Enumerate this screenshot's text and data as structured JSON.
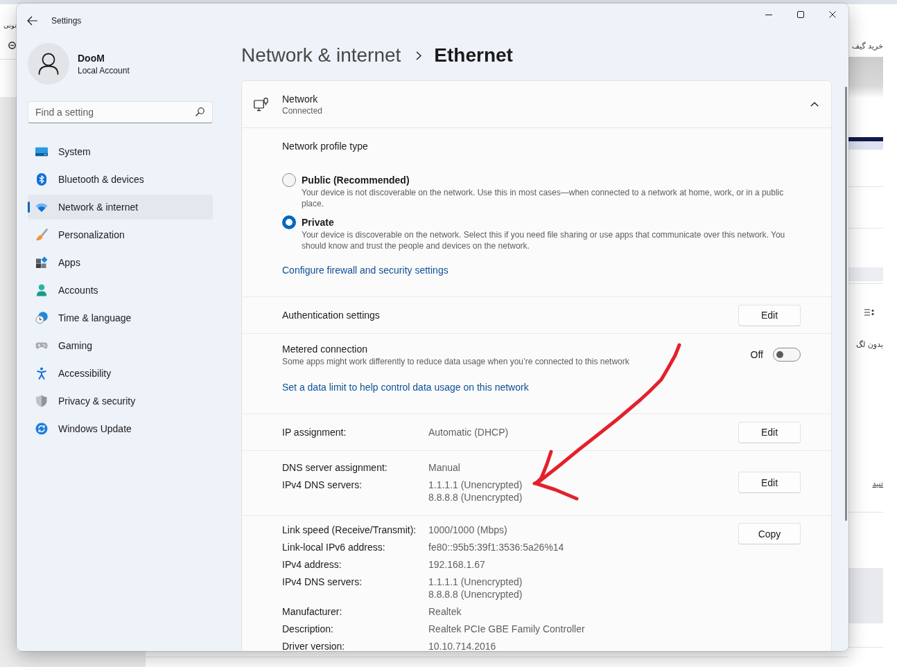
{
  "background_page": {
    "left_text": "تونی",
    "right_items": [
      {
        "kind": "text",
        "text": "خرید گیف"
      },
      {
        "kind": "text",
        "text": "بدون لگ"
      },
      {
        "kind": "link",
        "text": "تنید"
      }
    ]
  },
  "window": {
    "title": "Settings"
  },
  "profile": {
    "name": "DooM",
    "account_type": "Local Account"
  },
  "search": {
    "placeholder": "Find a setting"
  },
  "sidebar": {
    "items": [
      {
        "label": "System",
        "selected": false
      },
      {
        "label": "Bluetooth & devices",
        "selected": false
      },
      {
        "label": "Network & internet",
        "selected": true
      },
      {
        "label": "Personalization",
        "selected": false
      },
      {
        "label": "Apps",
        "selected": false
      },
      {
        "label": "Accounts",
        "selected": false
      },
      {
        "label": "Time & language",
        "selected": false
      },
      {
        "label": "Gaming",
        "selected": false
      },
      {
        "label": "Accessibility",
        "selected": false
      },
      {
        "label": "Privacy & security",
        "selected": false
      },
      {
        "label": "Windows Update",
        "selected": false
      }
    ]
  },
  "breadcrumb": {
    "parent": "Network & internet",
    "current": "Ethernet"
  },
  "network_card": {
    "title": "Network",
    "status": "Connected",
    "expanded": true
  },
  "profile_type": {
    "heading": "Network profile type",
    "options": [
      {
        "label": "Public (Recommended)",
        "description": "Your device is not discoverable on the network. Use this in most cases—when connected to a network at home, work, or in a public place.",
        "selected": false
      },
      {
        "label": "Private",
        "description": "Your device is discoverable on the network. Select this if you need file sharing or use apps that communicate over this network. You should know and trust the people and devices on the network.",
        "selected": true
      }
    ],
    "link": "Configure firewall and security settings"
  },
  "authentication": {
    "label": "Authentication settings",
    "button": "Edit"
  },
  "metered": {
    "label": "Metered connection",
    "description": "Some apps might work differently to reduce data usage when you’re connected to this network",
    "state_label": "Off",
    "on": false,
    "link": "Set a data limit to help control data usage on this network"
  },
  "ip_assignment": {
    "label": "IP assignment:",
    "value": "Automatic (DHCP)",
    "button": "Edit"
  },
  "dns": {
    "rows": [
      {
        "label": "DNS server assignment:",
        "values": [
          "Manual"
        ]
      },
      {
        "label": "IPv4 DNS servers:",
        "values": [
          "1.1.1.1 (Unencrypted)",
          "8.8.8.8 (Unencrypted)"
        ]
      }
    ],
    "button": "Edit"
  },
  "properties": {
    "rows": [
      {
        "label": "Link speed (Receive/Transmit):",
        "values": [
          "1000/1000 (Mbps)"
        ]
      },
      {
        "label": "Link-local IPv6 address:",
        "values": [
          "fe80::95b5:39f1:3536:5a26%14"
        ]
      },
      {
        "label": "IPv4 address:",
        "values": [
          "192.168.1.67"
        ]
      },
      {
        "label": "IPv4 DNS servers:",
        "values": [
          "1.1.1.1 (Unencrypted)",
          "8.8.8.8 (Unencrypted)"
        ]
      },
      {
        "label": "Manufacturer:",
        "values": [
          "Realtek"
        ]
      },
      {
        "label": "Description:",
        "values": [
          "Realtek PCIe GBE Family Controller"
        ]
      },
      {
        "label": "Driver version:",
        "values": [
          "10.10.714.2016"
        ]
      }
    ],
    "button": "Copy"
  }
}
